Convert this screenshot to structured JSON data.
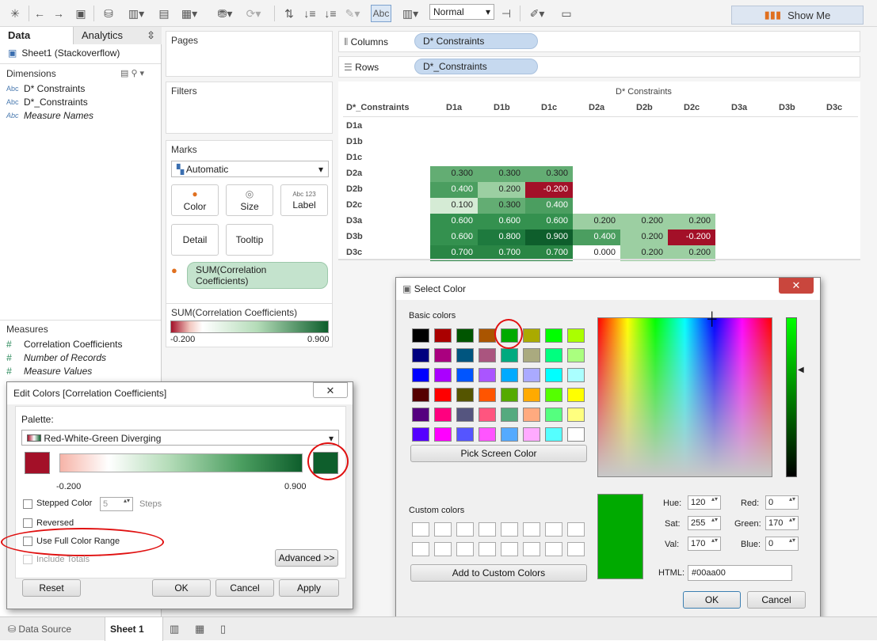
{
  "toolbar": {
    "zoom_label": "Normal",
    "show_me": "Show Me",
    "abc_label": "Abc"
  },
  "left": {
    "tab_data": "Data",
    "tab_analytics": "Analytics",
    "datasource": "Sheet1 (Stackoverflow)",
    "dimensions_header": "Dimensions",
    "dimensions": [
      "D* Constraints",
      "D*_Constraints",
      "Measure Names"
    ],
    "measures_header": "Measures",
    "measures": [
      "Correlation Coefficients",
      "Number of Records",
      "Measure Values"
    ],
    "abc_glyph": "Abc",
    "hash_glyph": "#"
  },
  "shelves": {
    "pages": "Pages",
    "filters": "Filters",
    "marks": "Marks",
    "columns": "Columns",
    "rows": "Rows",
    "columns_pill": "D* Constraints",
    "rows_pill": "D*_Constraints",
    "mark_type": "Automatic",
    "mark_buttons": [
      "Color",
      "Size",
      "Label",
      "Detail",
      "Tooltip"
    ],
    "label_glyph": "Abc 123",
    "color_pill": "SUM(Correlation Coefficients)",
    "legend_title": "SUM(Correlation Coefficients)",
    "legend_min": "-0.200",
    "legend_max": "0.900"
  },
  "viz": {
    "col_title": "D* Constraints",
    "row_header": "D*_Constraints",
    "columns": [
      "D1a",
      "D1b",
      "D1c",
      "D2a",
      "D2b",
      "D2c",
      "D3a",
      "D3b",
      "D3c"
    ],
    "rows": [
      "D1a",
      "D1b",
      "D1c",
      "D2a",
      "D2b",
      "D2c",
      "D3a",
      "D3b",
      "D3c"
    ],
    "cells": [
      [],
      [],
      [],
      [
        "0.300",
        "0.300",
        "0.300"
      ],
      [
        "0.400",
        "0.200",
        "-0.200"
      ],
      [
        "0.100",
        "0.300",
        "0.400"
      ],
      [
        "0.600",
        "0.600",
        "0.600",
        "0.200",
        "0.200",
        "0.200"
      ],
      [
        "0.600",
        "0.800",
        "0.900",
        "0.400",
        "0.200",
        "-0.200"
      ],
      [
        "0.700",
        "0.700",
        "0.700",
        "0.000",
        "0.200",
        "0.200"
      ]
    ],
    "colors": [
      [],
      [],
      [],
      [
        "#63ad73",
        "#63ad73",
        "#63ad73"
      ],
      [
        "#4b9e60",
        "#9ccfa2",
        "#a31028"
      ],
      [
        "#d5ebd5",
        "#63ad73",
        "#4b9e60"
      ],
      [
        "#34914f",
        "#34914f",
        "#34914f",
        "#9ccfa2",
        "#9ccfa2",
        "#9ccfa2"
      ],
      [
        "#34914f",
        "#1e7a3e",
        "#0e5e2c",
        "#4b9e60",
        "#9ccfa2",
        "#a31028"
      ],
      [
        "#2a8645",
        "#2a8645",
        "#2a8645",
        "#ffffff",
        "#9ccfa2",
        "#9ccfa2"
      ]
    ]
  },
  "edit_colors": {
    "title": "Edit Colors [Correlation Coefficients]",
    "close": "✕",
    "palette_label": "Palette:",
    "palette_value": "Red-White-Green Diverging",
    "min": "-0.200",
    "max": "0.900",
    "stepped": "Stepped Color",
    "steps_value": "5",
    "steps_label": "Steps",
    "reversed": "Reversed",
    "full_range": "Use Full Color Range",
    "include_totals": "Include Totals",
    "advanced": "Advanced >>",
    "reset": "Reset",
    "ok": "OK",
    "cancel": "Cancel",
    "apply": "Apply",
    "start_color": "#a31028",
    "end_color": "#0e5e2c"
  },
  "select_color": {
    "title": "Select Color",
    "close": "✕",
    "basic_label": "Basic colors",
    "custom_label": "Custom colors",
    "pick_screen": "Pick Screen Color",
    "add_custom": "Add to Custom Colors",
    "hue_label": "Hue:",
    "hue": "120",
    "sat_label": "Sat:",
    "sat": "255",
    "val_label": "Val:",
    "val": "170",
    "red_label": "Red:",
    "red": "0",
    "green_label": "Green:",
    "green": "170",
    "blue_label": "Blue:",
    "blue": "0",
    "html_label": "HTML:",
    "html": "#00aa00",
    "ok": "OK",
    "cancel": "Cancel",
    "current_color": "#00aa00",
    "basic_colors": [
      [
        "#000000",
        "#aa0000",
        "#005500",
        "#aa5500",
        "#00aa00",
        "#aaaa00",
        "#00ff00",
        "#aaff00"
      ],
      [
        "#00007f",
        "#aa007f",
        "#00557f",
        "#aa557f",
        "#00aa7f",
        "#aaaa7f",
        "#00ff7f",
        "#aaff7f"
      ],
      [
        "#0000ff",
        "#aa00ff",
        "#0055ff",
        "#aa55ff",
        "#00aaff",
        "#aaaaff",
        "#00ffff",
        "#aaffff"
      ],
      [
        "#550000",
        "#ff0000",
        "#555500",
        "#ff5500",
        "#55aa00",
        "#ffaa00",
        "#55ff00",
        "#ffff00"
      ],
      [
        "#55007f",
        "#ff007f",
        "#55557f",
        "#ff557f",
        "#55aa7f",
        "#ffaa7f",
        "#55ff7f",
        "#ffff7f"
      ],
      [
        "#5500ff",
        "#ff00ff",
        "#5555ff",
        "#ff55ff",
        "#55aaff",
        "#ffaaff",
        "#55ffff",
        "#ffffff"
      ]
    ]
  },
  "bottom": {
    "data_source": "Data Source",
    "sheet1": "Sheet 1"
  }
}
